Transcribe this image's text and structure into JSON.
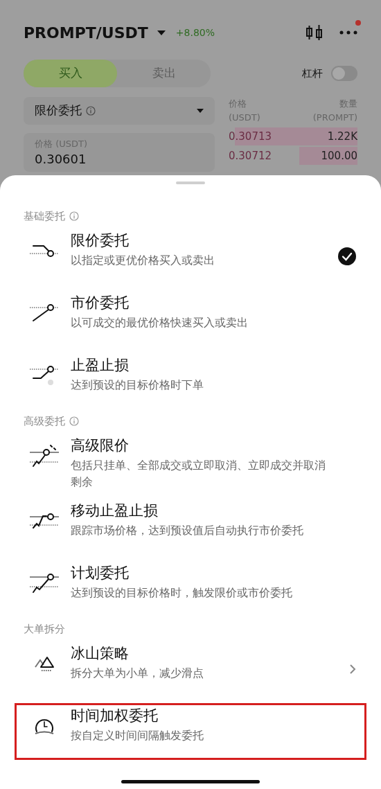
{
  "header": {
    "pair": "PROMPT/USDT",
    "change": "+8.80%"
  },
  "side_tabs": [
    {
      "label": "买入",
      "selected": true
    },
    {
      "label": "卖出",
      "selected": false
    }
  ],
  "leverage": {
    "label": "杠杆",
    "on": false
  },
  "order_type_select": {
    "value": "限价委托"
  },
  "price_field": {
    "label": "价格 (USDT)",
    "value": "0.30601"
  },
  "order_book": {
    "price_header": "价格\n(USDT)",
    "qty_header": "数量\n(PROMPT)",
    "rows": [
      {
        "price": "0.30713",
        "qty": "1.22K"
      },
      {
        "price": "0.30712",
        "qty": "100.00"
      }
    ]
  },
  "sheet": {
    "sections": [
      {
        "title": "基础委托",
        "info": true,
        "items": [
          {
            "kind": "limit",
            "title": "限价委托",
            "subtitle": "以指定或更优价格买入或卖出",
            "selected": true,
            "submenu": false,
            "highlighted": false
          },
          {
            "kind": "market",
            "title": "市价委托",
            "subtitle": "以可成交的最优价格快速买入或卖出",
            "selected": false,
            "submenu": false,
            "highlighted": false
          },
          {
            "kind": "tpsl",
            "title": "止盈止损",
            "subtitle": "达到预设的目标价格时下单",
            "selected": false,
            "submenu": false,
            "highlighted": false
          }
        ]
      },
      {
        "title": "高级委托",
        "info": true,
        "items": [
          {
            "kind": "advanced",
            "title": "高级限价",
            "subtitle": "包括只挂单、全部成交或立即取消、立即成交并取消剩余",
            "selected": false,
            "submenu": false,
            "highlighted": false
          },
          {
            "kind": "trailing",
            "title": "移动止盈止损",
            "subtitle": "跟踪市场价格，达到预设值后自动执行市价委托",
            "selected": false,
            "submenu": false,
            "highlighted": false
          },
          {
            "kind": "plan",
            "title": "计划委托",
            "subtitle": "达到预设的目标价格时，触发限价或市价委托",
            "selected": false,
            "submenu": false,
            "highlighted": false
          }
        ]
      },
      {
        "title": "大单拆分",
        "info": false,
        "items": [
          {
            "kind": "iceberg",
            "title": "冰山策略",
            "subtitle": "拆分大单为小单，减少滑点",
            "selected": false,
            "submenu": true,
            "highlighted": false
          },
          {
            "kind": "twap",
            "title": "时间加权委托",
            "subtitle": "按自定义时间间隔触发委托",
            "selected": false,
            "submenu": false,
            "highlighted": true
          }
        ]
      }
    ]
  }
}
